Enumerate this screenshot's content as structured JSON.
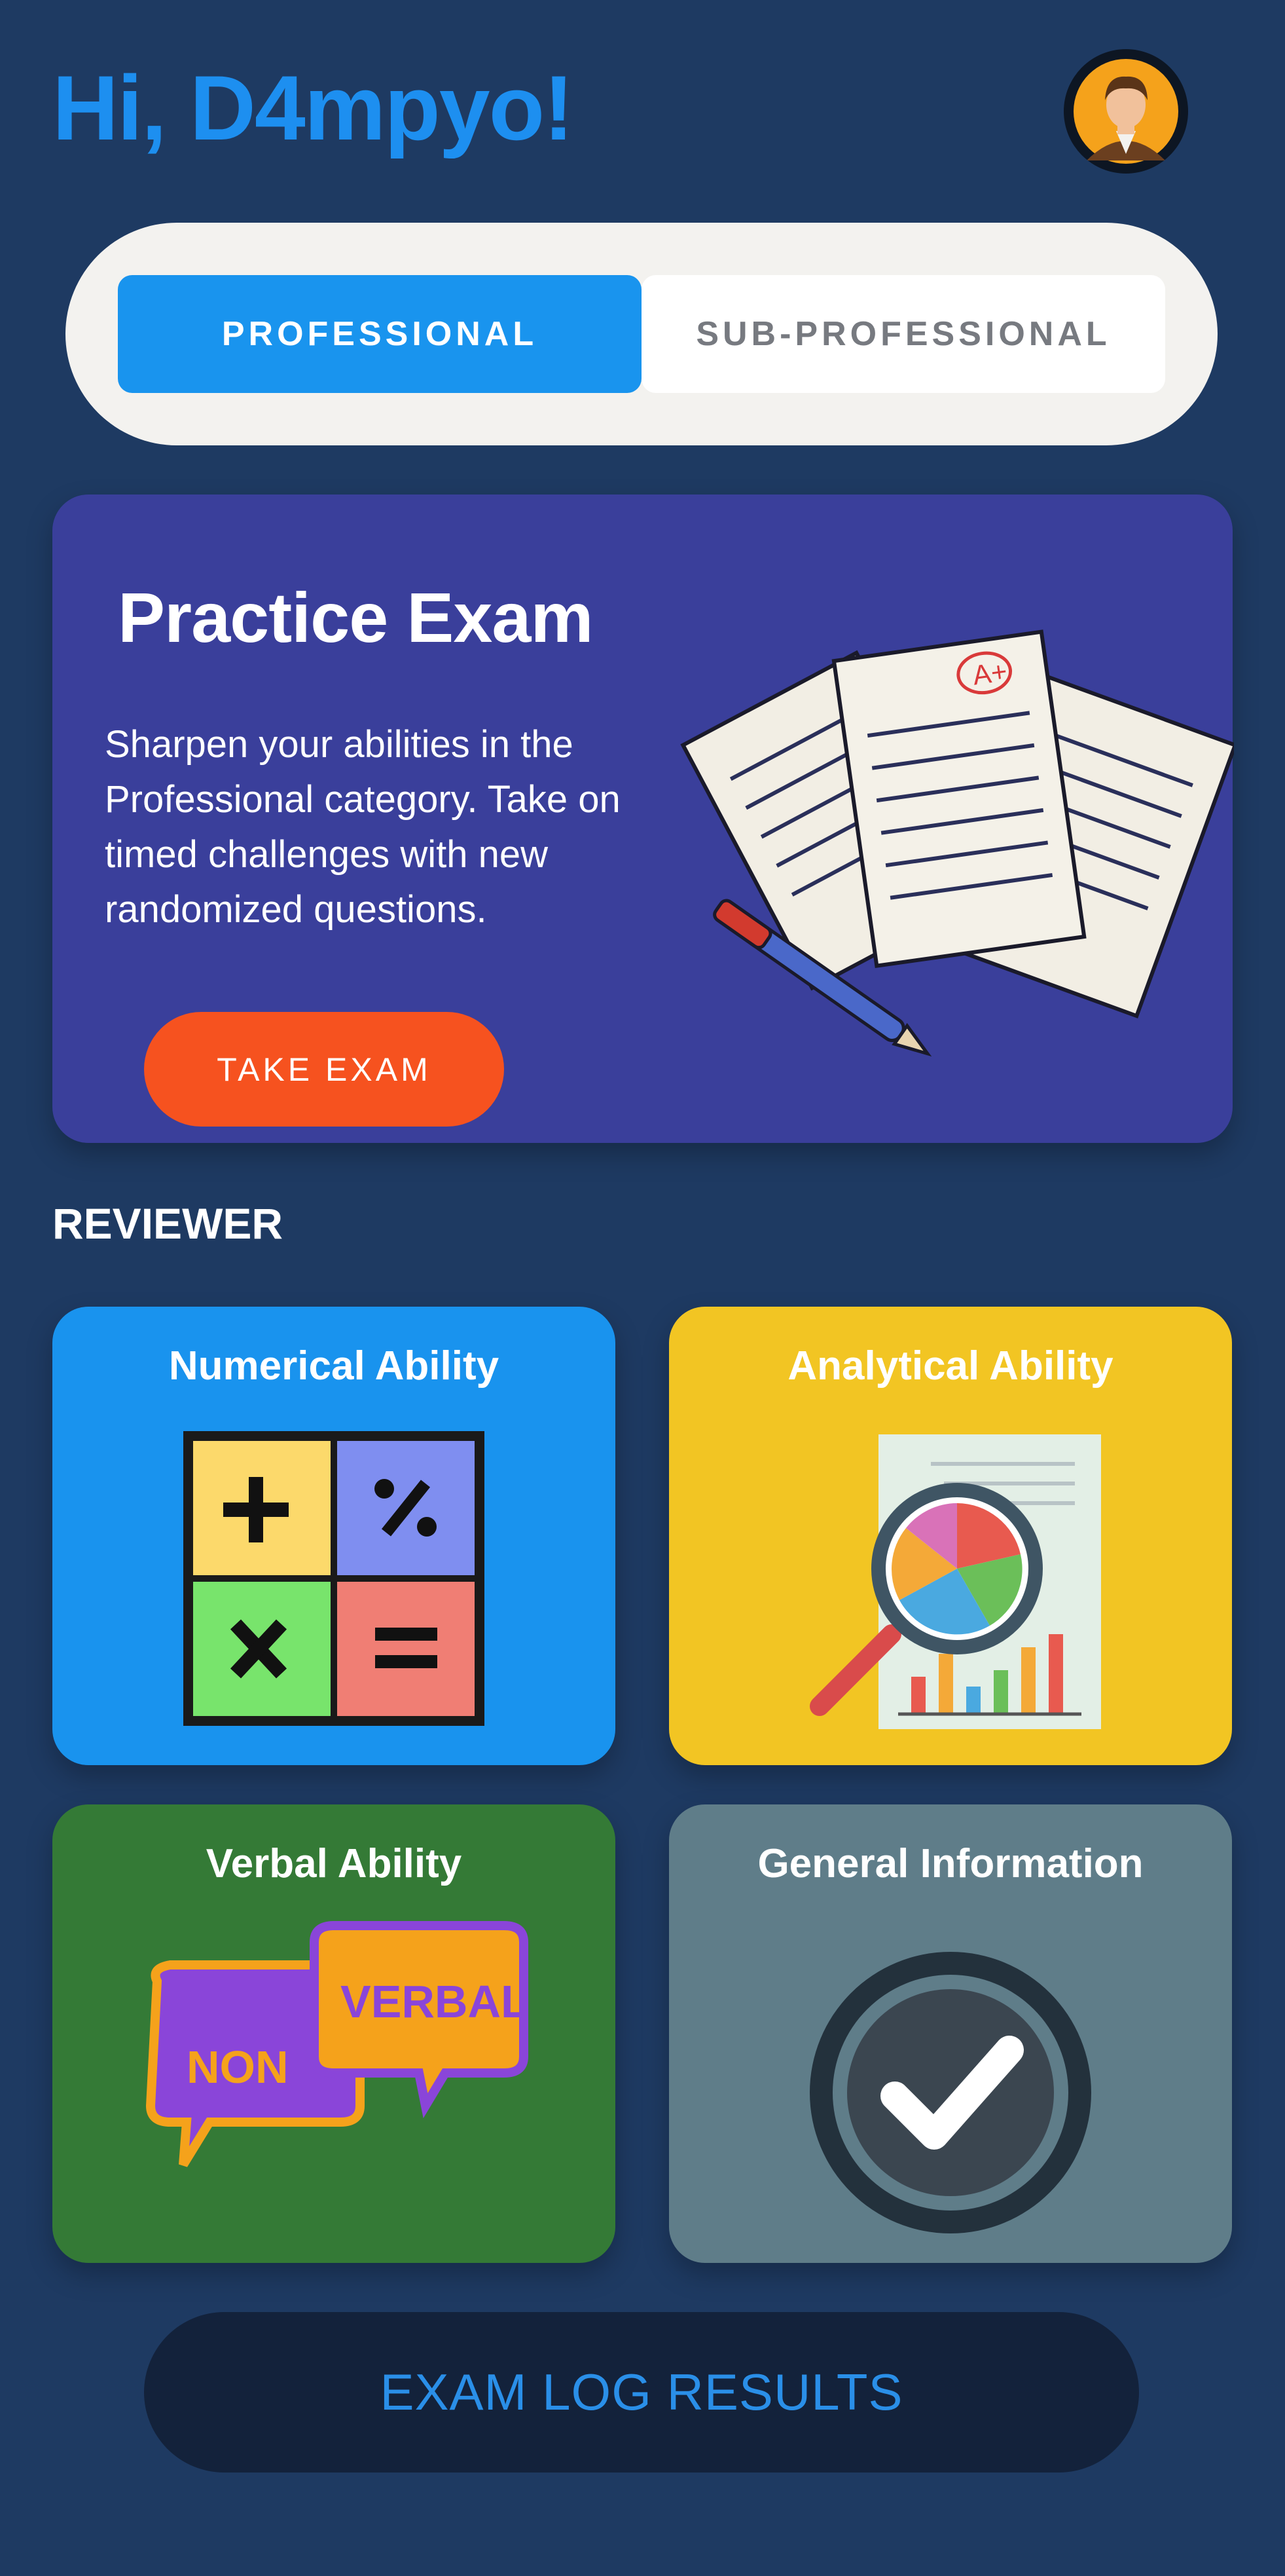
{
  "header": {
    "greeting": "Hi, D4mpyo!"
  },
  "tabs": [
    {
      "label": "PROFESSIONAL",
      "active": true
    },
    {
      "label": "SUB-PROFESSIONAL",
      "active": false
    }
  ],
  "practice": {
    "title": "Practice Exam",
    "description": "Sharpen your abilities in the Professional category. Take on timed challenges with new randomized questions.",
    "button_label": "TAKE EXAM",
    "grade_mark": "A+"
  },
  "reviewer": {
    "heading": "REVIEWER",
    "cards": [
      {
        "title": "Numerical Ability",
        "color": "#1993ee",
        "icon": "math-operators-icon"
      },
      {
        "title": "Analytical Ability",
        "color": "#f2c523",
        "icon": "chart-magnifier-icon"
      },
      {
        "title": "Verbal Ability",
        "color": "#347a36",
        "icon": "speech-bubbles-icon",
        "bubble_back": "NON",
        "bubble_front": "VERBAL"
      },
      {
        "title": "General Information",
        "color": "#5f7d89",
        "icon": "checkmark-icon"
      }
    ]
  },
  "footer": {
    "exam_log_label": "EXAM LOG RESULTS"
  },
  "colors": {
    "background": "#1e3a62",
    "accent": "#1d8ff0",
    "cta": "#f6521f",
    "practice_card": "#3a3f9b"
  }
}
